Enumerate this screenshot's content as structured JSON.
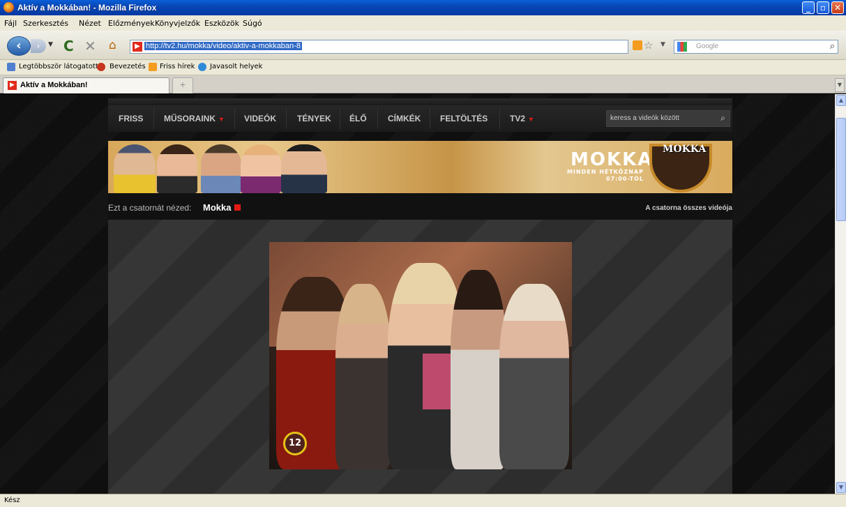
{
  "window": {
    "title": "Aktív a Mokkában! - Mozilla Firefox"
  },
  "menu": [
    "Fájl",
    "Szerkesztés",
    "Nézet",
    "Előzmények",
    "Könyvjelzők",
    "Eszközök",
    "Súgó"
  ],
  "navbar": {
    "url": "http://tv2.hu/mokka/video/aktiv-a-mokkaban-8",
    "search_placeholder": "Google"
  },
  "bookmarks": [
    "Legtöbbször látogatott",
    "Bevezetés",
    "Friss hírek",
    "Javasolt helyek"
  ],
  "tabs": {
    "active_label": "Aktív a Mokkában!",
    "new_tab_symbol": "+"
  },
  "site": {
    "nav": [
      "FRISS",
      "MŰSORAINK",
      "VIDEÓK",
      "TÉNYEK",
      "ÉLŐ",
      "CÍMKÉK",
      "FELTÖLTÉS",
      "TV2"
    ],
    "search_placeholder": "keress a videók között",
    "banner": {
      "title": "MOKKA",
      "subtitle_line1": "MINDEN HÉTKÖZNAP",
      "subtitle_line2": "07:00-TÓL",
      "logo": "MOKKA"
    },
    "channel": {
      "prefix": "Ezt a csatornát nézed:",
      "name": "Mokka",
      "all_videos": "A csatorna összes videója"
    },
    "video": {
      "rating_badge": "12"
    }
  },
  "status": {
    "text": "Kész"
  },
  "colors": {
    "accent_red": "#e41b13",
    "xp_blue": "#0339a4",
    "banner_gold": "#d8a85a"
  }
}
